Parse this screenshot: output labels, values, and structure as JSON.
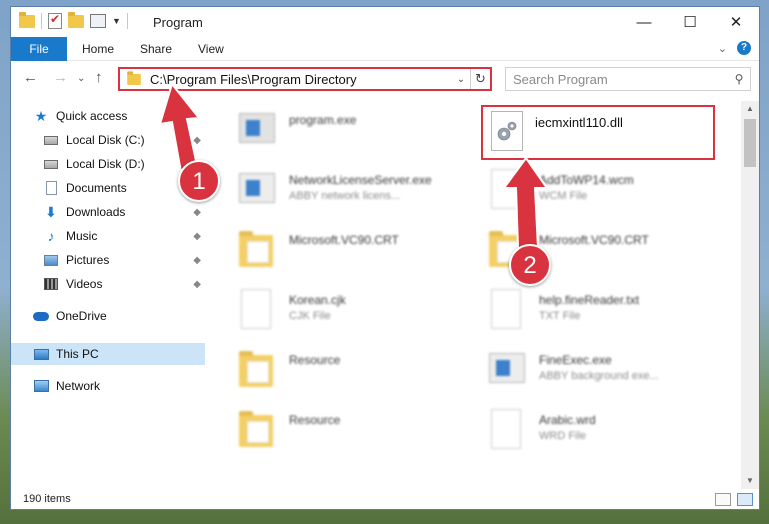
{
  "window": {
    "title": "Program",
    "controls": {
      "minimize": "—",
      "maximize": "☐",
      "close": "✕"
    }
  },
  "ribbon": {
    "tabs": [
      "File",
      "Home",
      "Share",
      "View"
    ],
    "help": "?",
    "expand": "⌄"
  },
  "navigation": {
    "back": "←",
    "forward": "→",
    "recent": "⌄",
    "up": "↑",
    "address": "C:\\Program Files\\Program Directory",
    "address_dropdown": "⌄",
    "refresh": "↻",
    "search_placeholder": "Search Program",
    "search_icon": "search-icon"
  },
  "sidebar": {
    "items": [
      {
        "label": "Quick access",
        "icon": "star-icon",
        "pinned": false
      },
      {
        "label": "Local Disk (C:)",
        "icon": "disk-icon",
        "pinned": true
      },
      {
        "label": "Local Disk (D:)",
        "icon": "disk-icon",
        "pinned": false
      },
      {
        "label": "Documents",
        "icon": "documents-icon",
        "pinned": true
      },
      {
        "label": "Downloads",
        "icon": "download-icon",
        "pinned": true
      },
      {
        "label": "Music",
        "icon": "music-icon",
        "pinned": true
      },
      {
        "label": "Pictures",
        "icon": "pictures-icon",
        "pinned": true
      },
      {
        "label": "Videos",
        "icon": "videos-icon",
        "pinned": true
      },
      {
        "label": "OneDrive",
        "icon": "cloud-icon",
        "pinned": false
      },
      {
        "label": "This PC",
        "icon": "computer-icon",
        "pinned": false,
        "selected": true
      },
      {
        "label": "Network",
        "icon": "network-icon",
        "pinned": false
      }
    ],
    "pin_glyph": "📌"
  },
  "files": [
    {
      "name": "program.exe",
      "desc": "",
      "icon": "setup-icon"
    },
    {
      "name": "iecmxintl110.dll",
      "desc": "",
      "icon": "dll-gear-icon",
      "highlighted": true
    },
    {
      "name": "NetworkLicenseServer.exe",
      "desc": "ABBY network licens...",
      "icon": "exe-icon"
    },
    {
      "name": "AddToWP14.wcm",
      "desc": "WCM File",
      "icon": "document-icon"
    },
    {
      "name": "Microsoft.VC90.CRT",
      "desc": "",
      "icon": "folder-icon"
    },
    {
      "name": "Microsoft.VC90.CRT",
      "desc": "",
      "icon": "folder-icon"
    },
    {
      "name": "Korean.cjk",
      "desc": "CJK File",
      "icon": "document-icon"
    },
    {
      "name": "help.fineReader.txt",
      "desc": "TXT File",
      "icon": "document-icon"
    },
    {
      "name": "Resource",
      "desc": "",
      "icon": "folder-icon"
    },
    {
      "name": "FineExec.exe",
      "desc": "ABBY background exe...",
      "icon": "exe-icon"
    },
    {
      "name": "Resource",
      "desc": "",
      "icon": "folder-icon"
    },
    {
      "name": "Arabic.wrd",
      "desc": "WRD File",
      "icon": "document-icon"
    }
  ],
  "annotations": {
    "step1": "1",
    "step2": "2",
    "color": "#d9333f"
  },
  "status": {
    "item_count": "190 items"
  },
  "colors": {
    "accent": "#1979ca",
    "highlight": "#d9333f",
    "selected_nav": "#cce4f7"
  }
}
